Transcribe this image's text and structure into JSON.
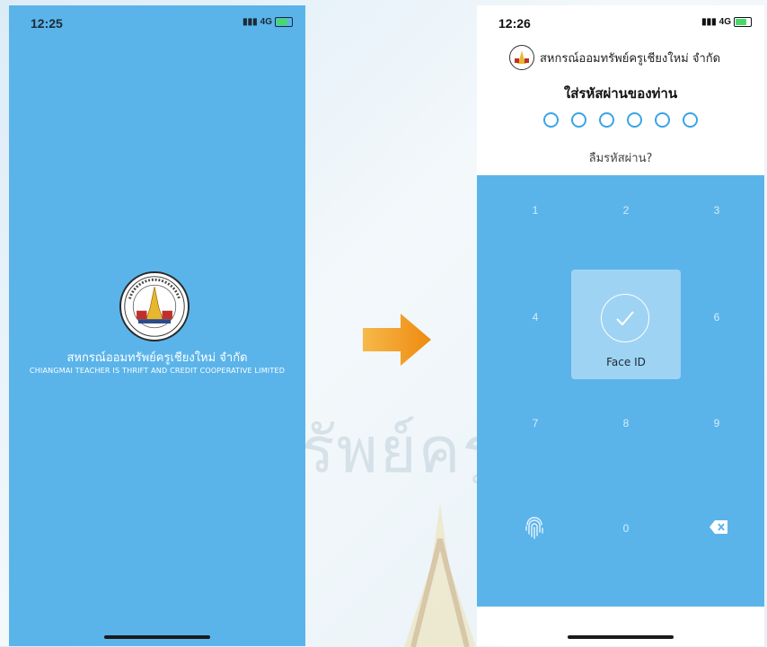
{
  "phone1": {
    "status_time": "12:25",
    "signal": "4G",
    "org_name_th": "สหกรณ์ออมทรัพย์ครูเชียงใหม่ จำกัด",
    "org_name_en": "CHIANGMAI TEACHER IS THRIFT AND CREDIT COOPERATIVE LIMITED"
  },
  "phone2": {
    "status_time": "12:26",
    "signal": "4G",
    "org_name_th": "สหกรณ์ออมทรัพย์ครูเชียงใหม่ จำกัด",
    "pin_prompt": "ใส่รหัสผ่านของท่าน",
    "pin_length": 6,
    "forgot_label": "ลืมรหัสผ่าน?",
    "keys": {
      "k1": "1",
      "k2": "2",
      "k3": "3",
      "k4": "4",
      "k6": "6",
      "k7": "7",
      "k8": "8",
      "k9": "9",
      "k0": "0"
    },
    "face_id_label": "Face ID",
    "icons": {
      "fingerprint": "fingerprint-icon",
      "backspace": "backspace-icon",
      "face_id_check": "check-circle-icon"
    }
  },
  "background": {
    "watermark_text": "รัพย์ครู"
  },
  "colors": {
    "app_blue": "#5ab4ea",
    "dot_blue": "#3aa5e5",
    "arrow_orange": "#f39b1f"
  }
}
